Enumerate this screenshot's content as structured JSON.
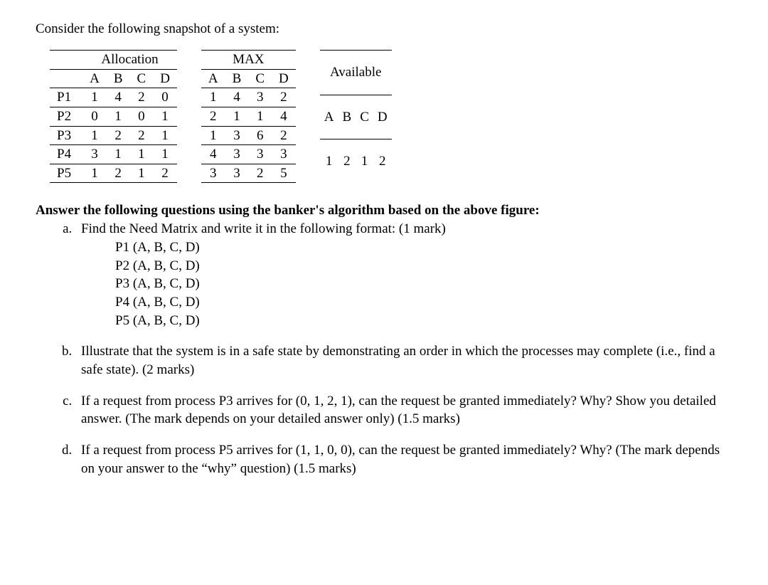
{
  "intro": "Consider the following snapshot of a system:",
  "table_headers": {
    "allocation": "Allocation",
    "max": "MAX",
    "available": "Available"
  },
  "cols": {
    "A": "A",
    "B": "B",
    "C": "C",
    "D": "D"
  },
  "procs": {
    "P1": "P1",
    "P2": "P2",
    "P3": "P3",
    "P4": "P4",
    "P5": "P5"
  },
  "allocation": {
    "P1": {
      "A": "1",
      "B": "4",
      "C": "2",
      "D": "0"
    },
    "P2": {
      "A": "0",
      "B": "1",
      "C": "0",
      "D": "1"
    },
    "P3": {
      "A": "1",
      "B": "2",
      "C": "2",
      "D": "1"
    },
    "P4": {
      "A": "3",
      "B": "1",
      "C": "1",
      "D": "1"
    },
    "P5": {
      "A": "1",
      "B": "2",
      "C": "1",
      "D": "2"
    }
  },
  "max": {
    "P1": {
      "A": "1",
      "B": "4",
      "C": "3",
      "D": "2"
    },
    "P2": {
      "A": "2",
      "B": "1",
      "C": "1",
      "D": "4"
    },
    "P3": {
      "A": "1",
      "B": "3",
      "C": "6",
      "D": "2"
    },
    "P4": {
      "A": "4",
      "B": "3",
      "C": "3",
      "D": "3"
    },
    "P5": {
      "A": "3",
      "B": "3",
      "C": "2",
      "D": "5"
    }
  },
  "available": {
    "A": "1",
    "B": "2",
    "C": "1",
    "D": "2"
  },
  "question_head": "Answer the following questions using the banker's algorithm based on the above figure:",
  "qa": "Find the Need Matrix and write it in the following format: (1 mark)",
  "need_format": {
    "l1": "P1 (A, B, C, D)",
    "l2": "P2 (A, B, C, D)",
    "l3": "P3 (A, B, C, D)",
    "l4": "P4 (A, B, C, D)",
    "l5": "P5 (A, B, C, D)"
  },
  "qb": "Illustrate that the system is in a safe state by demonstrating an order in which the processes may complete (i.e., find a safe state). (2 marks)",
  "qc": "If a request from process P3 arrives for (0, 1, 2, 1), can the request be granted immediately? Why? Show you detailed answer. (The mark depends on your detailed answer only) (1.5 marks)",
  "qd": "If a request from process P5 arrives for (1, 1, 0, 0), can the request be granted immediately? Why? (The mark depends on your answer to the “why” question) (1.5 marks)"
}
